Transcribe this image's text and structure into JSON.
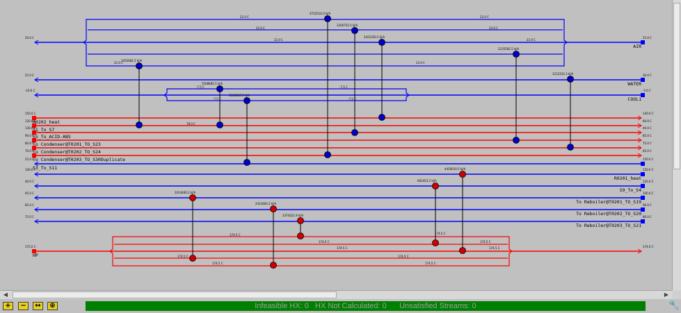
{
  "status_bar": {
    "text": "Infeasible HX: 0   HX Not Calculated: 0      Unsatisfied Streams: 0"
  },
  "toolbar": {
    "buttons": [
      {
        "name": "zoom-in-button",
        "icon": "plus-icon",
        "glyph": "+"
      },
      {
        "name": "zoom-out-button",
        "icon": "minus-icon",
        "glyph": "−"
      },
      {
        "name": "fit-width-button",
        "icon": "fit-width-icon",
        "glyph": "↔"
      },
      {
        "name": "fit-all-button",
        "icon": "fit-all-icon",
        "glyph": "⊕"
      }
    ],
    "wrench_icon": "wrench-icon"
  },
  "colors": {
    "cold_stream": "#0000ff",
    "hot_stream": "#ff0000",
    "cold_node": "#0000c8",
    "hot_node": "#d00000",
    "status_bg": "#008000",
    "background": "#c0c0c0"
  },
  "grid": {
    "streams": [
      {
        "id": "air",
        "type": "cold",
        "name": "AIR",
        "label_side": "right",
        "start_temp": "20.0 C",
        "end_temp": "25.0 C"
      },
      {
        "id": "water",
        "type": "cold",
        "name": "WATER",
        "label_side": "right",
        "start_temp": "25.0 C",
        "end_temp": "30.0 C"
      },
      {
        "id": "cool1",
        "type": "cold",
        "name": "COOL1",
        "label_side": "right",
        "start_temp": "-10.0 C",
        "end_temp": "-5.0 C"
      },
      {
        "id": "r202",
        "type": "hot",
        "name": "R0202_heat",
        "label_side": "left",
        "start_temp": "150.0 C",
        "end_temp": "140.0 C"
      },
      {
        "id": "s1s7",
        "type": "hot",
        "name": "S1_To_S7",
        "label_side": "left",
        "start_temp": "120.0 C",
        "end_temp": "60.0 C"
      },
      {
        "id": "s5abs",
        "type": "hot",
        "name": "S5_To_ACID-ABS",
        "label_side": "left",
        "start_temp": "130.0 C",
        "end_temp": "40.0 C"
      },
      {
        "id": "cond523",
        "type": "hot",
        "name": "To Condenser@T0201_TO_S23",
        "label_side": "left",
        "start_temp": "90.0 C",
        "end_temp": "85.0 C"
      },
      {
        "id": "cond524",
        "type": "hot",
        "name": "To Condenser@T0202_TO_S24",
        "label_side": "left",
        "start_temp": "80.0 C",
        "end_temp": "75.0 C"
      },
      {
        "id": "cond530",
        "type": "hot",
        "name": "To Condenser@T0203_TO_S30Duplicate",
        "label_side": "left",
        "start_temp": "70.0 C",
        "end_temp": "65.0 C"
      },
      {
        "id": "s3s11",
        "type": "cold",
        "name": "S3_To_S11",
        "label_side": "left",
        "start_temp": "25.0 C",
        "end_temp": "150.0 C"
      },
      {
        "id": "r201",
        "type": "cold",
        "name": "R0201_heat",
        "label_side": "right",
        "start_temp": "140.0 C",
        "end_temp": "150.0 C"
      },
      {
        "id": "s9s4",
        "type": "cold",
        "name": "S9_To_S4",
        "label_side": "right",
        "start_temp": "40.0 C",
        "end_temp": "120.0 C"
      },
      {
        "id": "reb519",
        "type": "cold",
        "name": "To Reboiler@T0201_TO_S19",
        "label_side": "right",
        "start_temp": "95.0 C",
        "end_temp": "100.0 C"
      },
      {
        "id": "reb520",
        "type": "cold",
        "name": "To Reboiler@T0202_TO_S20",
        "label_side": "right",
        "start_temp": "85.0 C",
        "end_temp": "90.0 C"
      },
      {
        "id": "reb521",
        "type": "cold",
        "name": "To Reboiler@T0203_TO_S21",
        "label_side": "right",
        "start_temp": "75.0 C",
        "end_temp": "80.0 C"
      },
      {
        "id": "hp",
        "type": "hot",
        "name": "HP",
        "label_side": "left",
        "start_temp": "175.0 C",
        "end_temp": "174.0 C"
      }
    ],
    "exchangers": [
      {
        "id": "e1",
        "duty": "4722214.0 kJ/h"
      },
      {
        "id": "e2",
        "duty": "3356752.5 kJ/h"
      },
      {
        "id": "e3",
        "duty": "2201350.5 kJ/h"
      },
      {
        "id": "e4",
        "duty": "2235582.5 kJ/h"
      },
      {
        "id": "e5",
        "duty": "3355682.5 kJ/h"
      },
      {
        "id": "e6",
        "duty": "5568682.5 kJ/h"
      },
      {
        "id": "e7",
        "duty": "3340063.5 kJ/h"
      },
      {
        "id": "e8",
        "duty": "1212333.3 kJ/h"
      },
      {
        "id": "e9",
        "duty": "4450010.5 kJ/h"
      },
      {
        "id": "e10",
        "duty": "662453.2 kJ/h"
      },
      {
        "id": "e11",
        "duty": "2413460.2 kJ/h"
      },
      {
        "id": "e12",
        "duty": "2413460.2 kJ/h"
      },
      {
        "id": "e13",
        "duty": "2374321.9 kJ/h"
      }
    ],
    "split_labels": {
      "air_upper": [
        "22.0 C",
        "23.0 C"
      ],
      "air_mid": [
        "22.0 C",
        "23.0 C"
      ],
      "air_inner": [
        "22.0 C",
        "23.0 C"
      ],
      "air_lower": [
        "22.0 C",
        "23.0 C"
      ],
      "cool_upper": [
        "-7.5 C",
        "-7.5 C"
      ],
      "cool_lower": [
        "-7.5 C",
        "-7.5 C"
      ],
      "hp_top": [
        "174.5 C",
        "174.5 C"
      ],
      "hp_mid": [
        "174.5 C",
        "174.5 C"
      ],
      "hp_inner": [
        "174.5 C",
        "174.5 C"
      ],
      "hp_bottom": [
        "174.5 C",
        "174.5 C"
      ],
      "hot_outlet_r202": "78.0 C",
      "cold_ex": [
        "174.5 C",
        "174.5 C"
      ]
    }
  }
}
